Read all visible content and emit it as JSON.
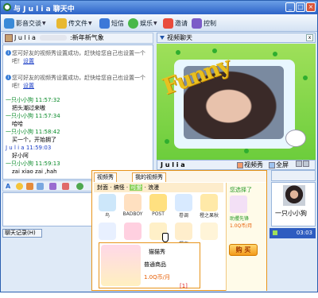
{
  "window": {
    "title": "与 J u l i a  聊天中"
  },
  "toolbar": {
    "items": [
      {
        "label": "影音交谈",
        "icon": "webcam-icon",
        "color": "#3a8ad8"
      },
      {
        "label": "传文件",
        "icon": "folder-icon",
        "color": "#e8b830"
      },
      {
        "label": "短信",
        "icon": "phone-icon",
        "color": "#3c78d8"
      },
      {
        "label": "娱乐",
        "icon": "disc-icon",
        "color": "#49b84a"
      },
      {
        "label": "邀请",
        "icon": "invite-icon",
        "color": "#e94c3c"
      },
      {
        "label": "控制",
        "icon": "control-icon",
        "color": "#7b5cc8"
      }
    ]
  },
  "userbar": {
    "name": "J u l i a",
    "status": ":新年新气象"
  },
  "chat": {
    "system_msgs": [
      {
        "text": "您可好友的视频秀设置成功，赶快给您自己也设置一个吧！",
        "link": "设置"
      },
      {
        "text": "您可好友的视频秀设置成功，赶快给您自己也设置一个吧！",
        "link": "设置"
      }
    ],
    "messages": [
      {
        "sender": "一只小小狗",
        "time": "11:57:32",
        "text": "把头潮过来嗷",
        "mine": true
      },
      {
        "sender": "一只小小狗",
        "time": "11:57:34",
        "text": "哈哈",
        "mine": true
      },
      {
        "sender": "一只小小狗",
        "time": "11:58:42",
        "text": "买一个，开始拥了",
        "mine": true
      },
      {
        "sender": "J u l i a",
        "time": "11:59:03",
        "text": "好小阿",
        "mine": false
      },
      {
        "sender": "一只小小狗",
        "time": "11:59:13",
        "text": "zai xiao zai ,hah",
        "mine": true
      }
    ]
  },
  "right": {
    "header": "视频聊天",
    "close": "x"
  },
  "video": {
    "overlay_text": "Funny",
    "name": "J u l i a",
    "show_label": "视频秀",
    "fullscreen_label": "全屏"
  },
  "small_video": {
    "name": "一只小小狗"
  },
  "bottom": {
    "history_label": "聊天记录(H)",
    "time": "03:03"
  },
  "popup": {
    "tabs": [
      "视频秀",
      "我的视频秀"
    ],
    "categories": {
      "a": "封面",
      "b": "搞怪",
      "sel": "可爱",
      "d": "浪漫"
    },
    "items": [
      {
        "label": "鸟",
        "color": "#cde7fa"
      },
      {
        "label": "BADBOY",
        "color": "#ffe0c0"
      },
      {
        "label": "POST",
        "color": "#ffe080"
      },
      {
        "label": "卷调",
        "color": "#d8eaff"
      },
      {
        "label": "橙之果秋",
        "color": "#ffe9a8"
      },
      {
        "label": "",
        "color": "#e8f0ff"
      },
      {
        "label": "",
        "color": "#ffd0e0"
      },
      {
        "label": "",
        "color": "#fff0c8"
      },
      {
        "label": "樱空",
        "color": "#ffeecc"
      },
      {
        "label": "",
        "color": "#fff4d8"
      }
    ],
    "detail": {
      "name": "猫猫秀",
      "grade": "普通商品",
      "price": "1.0Q币/月"
    },
    "page": "[1]",
    "side": {
      "title": "您选择了",
      "item": "助攫先锋",
      "price": "1.0Q币/月",
      "buy": "购 买"
    }
  }
}
